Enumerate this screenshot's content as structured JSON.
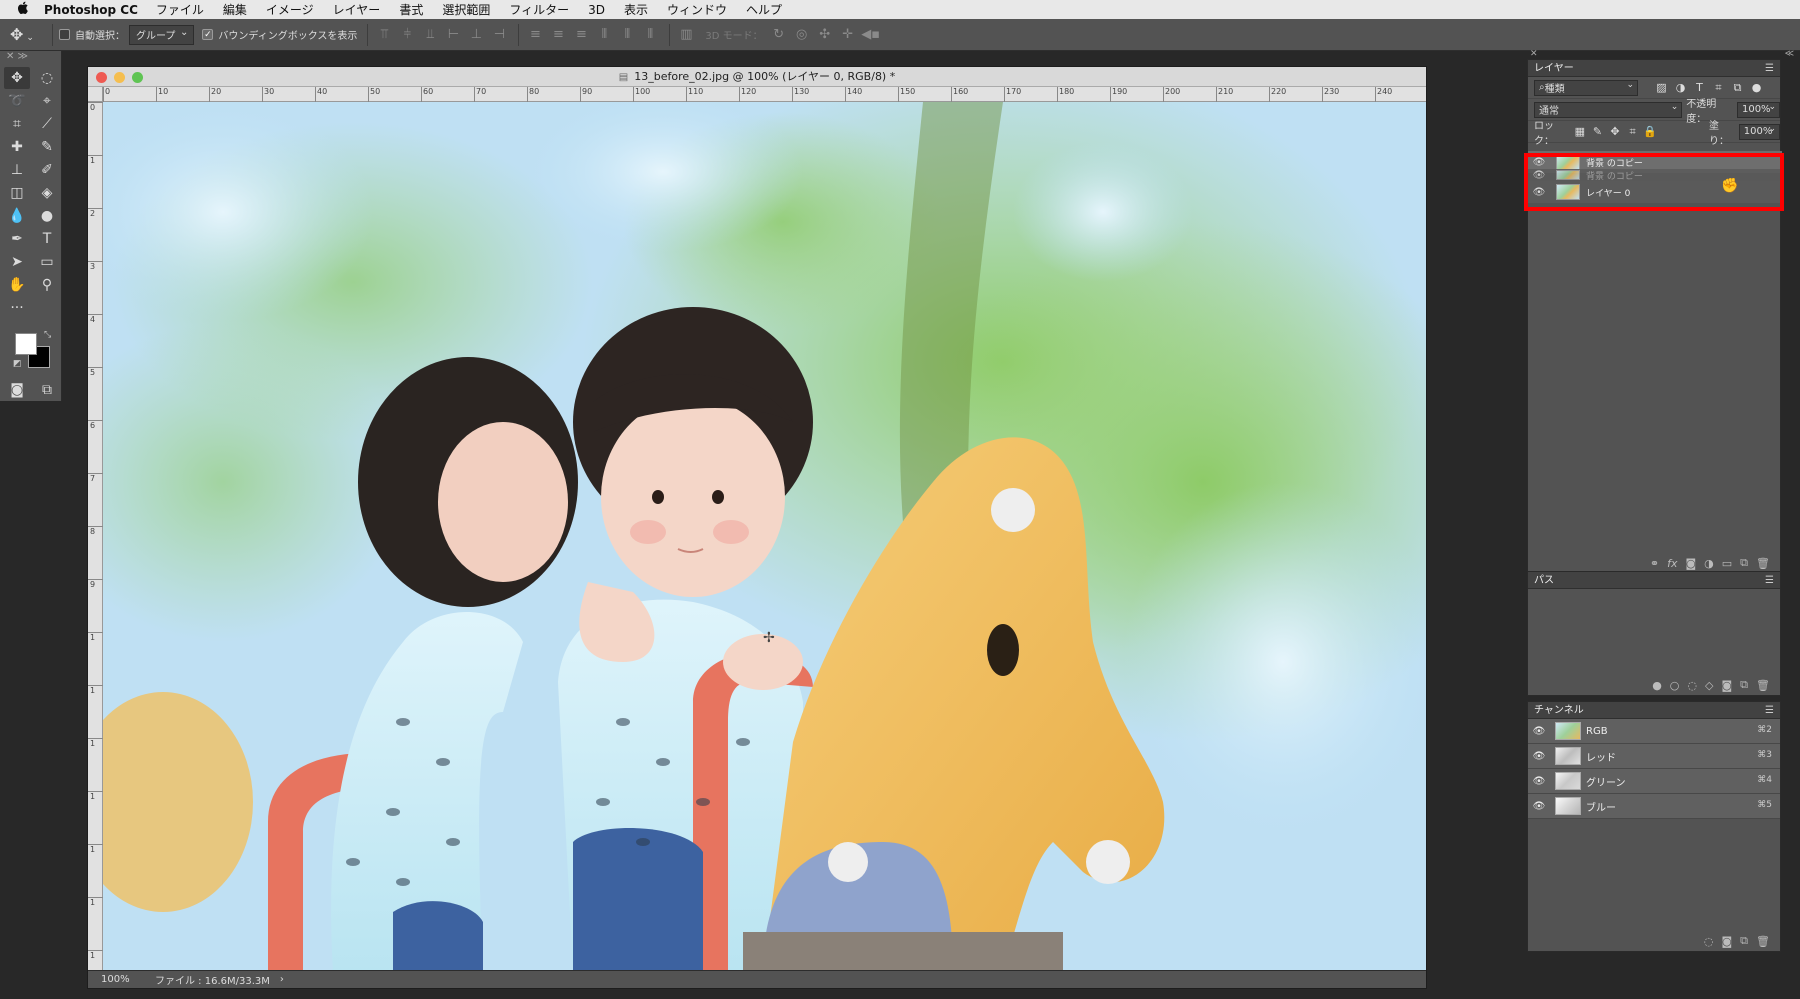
{
  "menubar": {
    "apple": "",
    "app": "Photoshop CC",
    "items": [
      "ファイル",
      "編集",
      "イメージ",
      "レイヤー",
      "書式",
      "選択範囲",
      "フィルター",
      "3D",
      "表示",
      "ウィンドウ",
      "ヘルプ"
    ]
  },
  "options": {
    "auto_select_label": "自動選択：",
    "auto_select_checked": false,
    "auto_select_target": "グループ",
    "bounding_box_label": "バウンディングボックスを表示",
    "bounding_box_checked": true,
    "mode_3d_label": "3D モード："
  },
  "document": {
    "title": "13_before_02.jpg @ 100% (レイヤー 0, RGB/8) *",
    "status_zoom": "100%",
    "status_file": "ファイル : 16.6M/33.3M",
    "ruler_h": [
      "0",
      "10",
      "20",
      "30",
      "40",
      "50",
      "60",
      "70",
      "80",
      "90",
      "100",
      "110",
      "120",
      "130",
      "140",
      "150",
      "160",
      "170",
      "180",
      "190",
      "200",
      "210",
      "220",
      "230",
      "240"
    ],
    "ruler_v": [
      "0",
      "1",
      "2",
      "3",
      "4",
      "5",
      "6",
      "7",
      "8",
      "9",
      "1",
      "1",
      "1",
      "1",
      "1",
      "1",
      "1"
    ]
  },
  "layers_panel": {
    "tab": "レイヤー",
    "filter_kind": "種類",
    "blend_mode": "通常",
    "opacity_label": "不透明度：",
    "opacity_value": "100%",
    "lock_label": "ロック：",
    "fill_label": "塗り：",
    "fill_value": "100%",
    "layers": [
      {
        "name": "背景 のコピー",
        "state": "selected"
      },
      {
        "name": "背景 のコピー",
        "state": "ghost"
      },
      {
        "name": "レイヤー 0",
        "state": "normal"
      }
    ],
    "highlight_color": "#ff0000"
  },
  "paths_panel": {
    "tab": "パス"
  },
  "channels_panel": {
    "tab": "チャンネル",
    "channels": [
      {
        "name": "RGB",
        "shortcut": "⌘2"
      },
      {
        "name": "レッド",
        "shortcut": "⌘3"
      },
      {
        "name": "グリーン",
        "shortcut": "⌘4"
      },
      {
        "name": "ブルー",
        "shortcut": "⌘5"
      }
    ]
  }
}
